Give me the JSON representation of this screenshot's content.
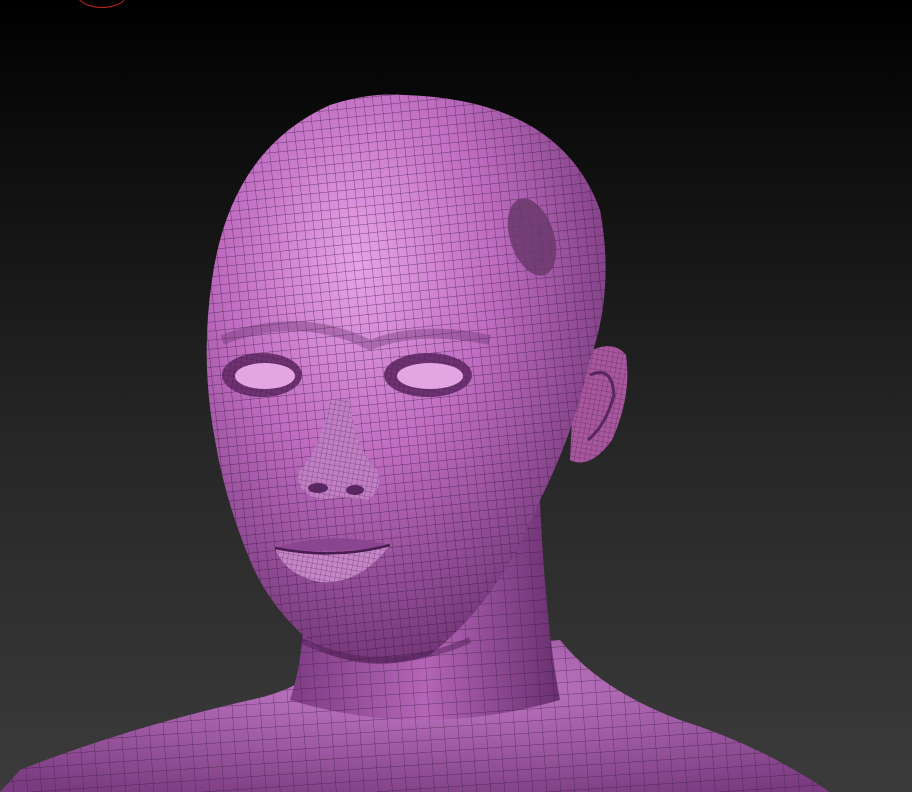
{
  "viewport": {
    "background_top": "#000000",
    "background_bottom": "#3b3b3b"
  },
  "model": {
    "subject": "female-head-bust",
    "material_color": "#b45fb6",
    "material_highlight": "#dc96dc",
    "material_shadow": "#5e2a64",
    "wireframe_color": "#2a1230",
    "wireframe_visible": true
  },
  "brush_cursor": {
    "color": "#c42222",
    "shape": "circle"
  }
}
